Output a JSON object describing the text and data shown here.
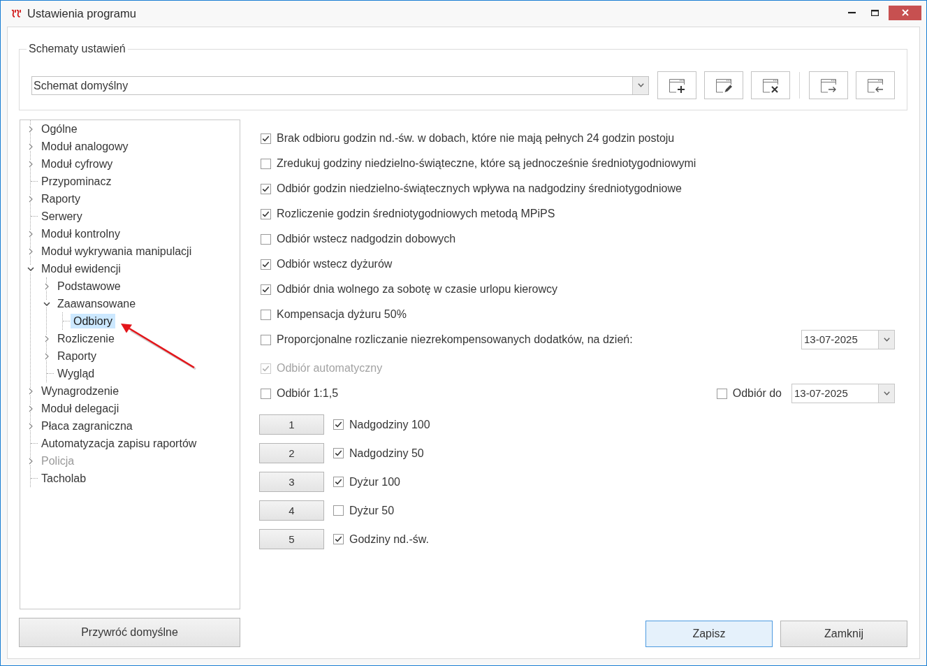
{
  "window": {
    "title": "Ustawienia programu"
  },
  "schemes": {
    "legend": "Schematy ustawień",
    "value": "Schemat domyślny"
  },
  "tree": [
    {
      "label": "Ogólne",
      "expanded": false,
      "selected": false,
      "disabled": false
    },
    {
      "label": "Moduł analogowy",
      "expanded": false,
      "selected": false,
      "disabled": false
    },
    {
      "label": "Moduł cyfrowy",
      "expanded": false,
      "selected": false,
      "disabled": false
    },
    {
      "label": "Przypominacz",
      "selected": false,
      "disabled": false
    },
    {
      "label": "Raporty",
      "expanded": false,
      "selected": false,
      "disabled": false
    },
    {
      "label": "Serwery",
      "selected": false,
      "disabled": false
    },
    {
      "label": "Moduł kontrolny",
      "expanded": false,
      "selected": false,
      "disabled": false
    },
    {
      "label": "Moduł wykrywania manipulacji",
      "expanded": false,
      "selected": false,
      "disabled": false
    },
    {
      "label": "Moduł ewidencji",
      "expanded": true,
      "selected": false,
      "disabled": false,
      "children": [
        {
          "label": "Podstawowe",
          "expanded": false,
          "selected": false,
          "disabled": false
        },
        {
          "label": "Zaawansowane",
          "expanded": true,
          "selected": false,
          "disabled": false,
          "children": [
            {
              "label": "Odbiory",
              "selected": true,
              "disabled": false
            }
          ]
        },
        {
          "label": "Rozliczenie",
          "expanded": false,
          "selected": false,
          "disabled": false
        },
        {
          "label": "Raporty",
          "expanded": false,
          "selected": false,
          "disabled": false
        },
        {
          "label": "Wygląd",
          "selected": false,
          "disabled": false
        }
      ]
    },
    {
      "label": "Wynagrodzenie",
      "expanded": false,
      "selected": false,
      "disabled": false
    },
    {
      "label": "Moduł delegacji",
      "expanded": false,
      "selected": false,
      "disabled": false
    },
    {
      "label": "Płaca zagraniczna",
      "expanded": false,
      "selected": false,
      "disabled": false
    },
    {
      "label": "Automatyzacja zapisu raportów",
      "selected": false,
      "disabled": false
    },
    {
      "label": "Policja",
      "expanded": false,
      "selected": false,
      "disabled": true
    },
    {
      "label": "Tacholab",
      "selected": false,
      "disabled": false
    }
  ],
  "options": [
    {
      "kind": "check",
      "label": "Brak odbioru godzin nd.-św. w dobach, które nie mają pełnych 24 godzin postoju",
      "checked": true,
      "disabled": false
    },
    {
      "kind": "check",
      "label": "Zredukuj godziny niedzielno-świąteczne, które są jednocześnie średniotygodniowymi",
      "checked": false,
      "disabled": false
    },
    {
      "kind": "check",
      "label": "Odbiór godzin niedzielno-świątecznych wpływa na nadgodziny średniotygodniowe",
      "checked": true,
      "disabled": false
    },
    {
      "kind": "check",
      "label": "Rozliczenie godzin średniotygodniowych metodą MPiPS",
      "checked": true,
      "disabled": false
    },
    {
      "kind": "check",
      "label": "Odbiór wstecz nadgodzin dobowych",
      "checked": false,
      "disabled": false
    },
    {
      "kind": "check",
      "label": "Odbiór wstecz dyżurów",
      "checked": true,
      "disabled": false
    },
    {
      "kind": "check",
      "label": "Odbiór dnia wolnego za sobotę w czasie urlopu kierowcy",
      "checked": true,
      "disabled": false
    },
    {
      "kind": "check",
      "label": "Kompensacja dyżuru 50%",
      "checked": false,
      "disabled": false
    },
    {
      "kind": "check_date",
      "label": "Proporcjonalne rozliczanie niezrekompensowanych dodatków, na dzień:",
      "checked": false,
      "disabled": false,
      "date": "13-07-2025"
    },
    {
      "kind": "check",
      "label": "Odbiór automatyczny",
      "checked": true,
      "disabled": true
    },
    {
      "kind": "check_pair",
      "label": "Odbiór 1:1,5",
      "checked": false,
      "disabled": false,
      "second": {
        "label": "Odbiór do",
        "checked": false
      },
      "date": "13-07-2025"
    }
  ],
  "priorities": [
    {
      "number": "1",
      "label": "Nadgodziny 100",
      "checked": true
    },
    {
      "number": "2",
      "label": "Nadgodziny 50",
      "checked": true
    },
    {
      "number": "3",
      "label": "Dyżur 100",
      "checked": true
    },
    {
      "number": "4",
      "label": "Dyżur 50",
      "checked": false
    },
    {
      "number": "5",
      "label": "Godziny nd.-św.",
      "checked": true
    }
  ],
  "footer": {
    "reset": "Przywróć domyślne",
    "actions": [
      {
        "label": "Zapisz",
        "focused": true
      },
      {
        "label": "Zamknij",
        "focused": false
      }
    ]
  }
}
